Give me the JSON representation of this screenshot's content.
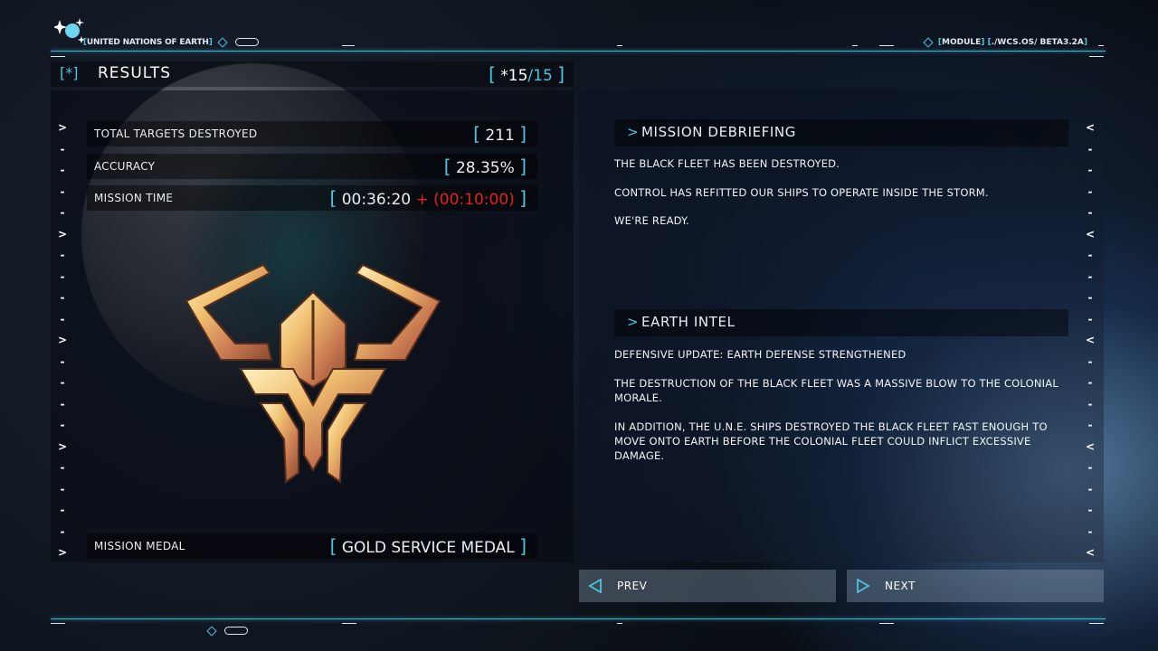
{
  "top_bar": {
    "org_label": "UNITED NATIONS OF EARTH",
    "module_label": "MODULE",
    "version_label": "./WCS.OS/ BETA3.2A"
  },
  "results_header": {
    "icon_text": "*",
    "title": "RESULTS",
    "count_done": "*15",
    "count_total": "/15"
  },
  "stats": [
    {
      "label": "TOTAL TARGETS DESTROYED",
      "value": "211"
    },
    {
      "label": "ACCURACY",
      "value": "28.35%"
    },
    {
      "label": "MISSION TIME",
      "value": "00:36:20",
      "plus": "+",
      "penalty": "(00:10:00)"
    }
  ],
  "medal": {
    "label": "MISSION MEDAL",
    "value": "GOLD SERVICE MEDAL",
    "icon": "gold-eagle-medal"
  },
  "debriefing": {
    "title": "MISSION DEBRIEFING",
    "paragraphs": [
      "THE BLACK FLEET HAS BEEN DESTROYED.",
      "CONTROL HAS REFITTED OUR SHIPS TO OPERATE INSIDE THE STORM.",
      "WE'RE READY."
    ]
  },
  "intel": {
    "title": "EARTH INTEL",
    "paragraphs": [
      "DEFENSIVE UPDATE: EARTH DEFENSE STRENGTHENED",
      "THE DESTRUCTION OF THE BLACK FLEET WAS A MASSIVE BLOW TO THE COLONIAL MORALE.",
      "IN ADDITION, THE U.N.E. SHIPS DESTROYED THE BLACK FLEET FAST ENOUGH TO MOVE ONTO EARTH BEFORE THE COLONIAL FLEET COULD INFLICT EXCESSIVE DAMAGE."
    ]
  },
  "nav": {
    "prev_label": "PREV",
    "next_label": "NEXT"
  },
  "colors": {
    "accent": "#4ec3e0",
    "penalty": "#e0231c"
  }
}
